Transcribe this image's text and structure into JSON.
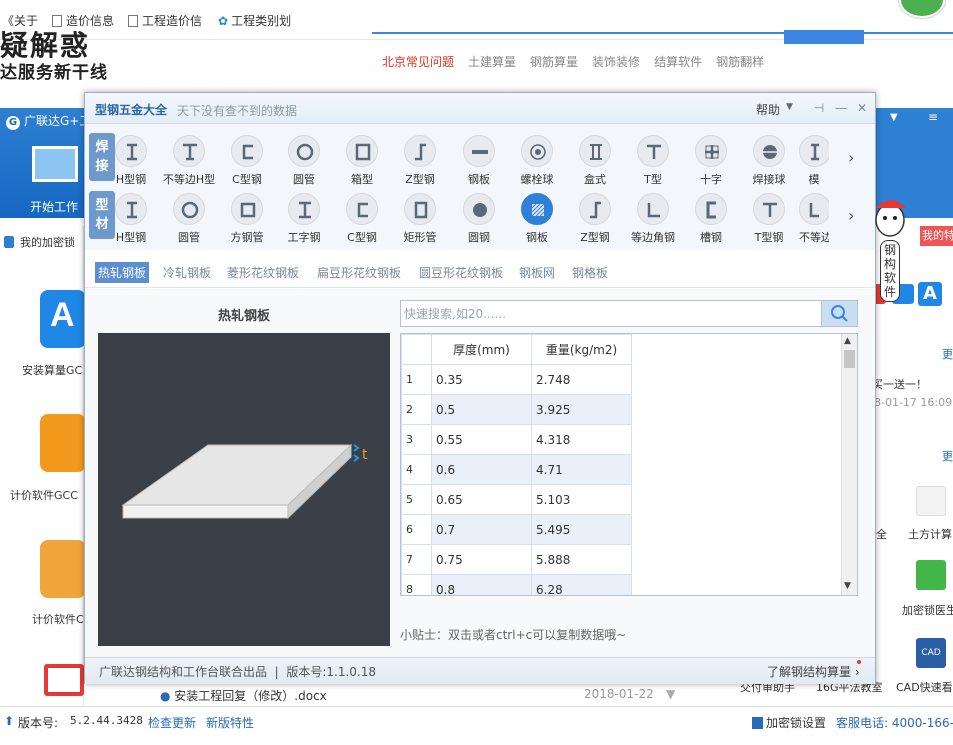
{
  "browser_bar": {
    "items": [
      "《关于",
      "造价信息",
      "工程造价信",
      "工程类别划"
    ]
  },
  "website": {
    "logo_line1": "疑解惑",
    "logo_line2": "达服务新干线",
    "links": [
      "北京常见问题",
      "土建算量",
      "钢筋算量",
      "装饰装修",
      "结算软件",
      "钢筋翻样"
    ]
  },
  "app": {
    "title": "广联达G+工",
    "start_work": "开始工作",
    "lock_label": "我的加密锁",
    "my_tab": "我的特",
    "left_apps": [
      "安装算量GC",
      "计价软件GCC",
      "计价软件C"
    ],
    "right_texts": {
      "more1": "更",
      "promo": "买一送一！",
      "date1": "8-01-17 16:09",
      "more2": "更",
      "quan": "全",
      "tufang": "土方计算",
      "jiamisuo": "加密锁医生",
      "cad": "CAD快速看",
      "jiaofu": "交付审助手",
      "g16": "16G平法教室"
    },
    "doc_row": {
      "name": "安装工程回复（修改）.docx",
      "date": "2018-01-22"
    },
    "status": {
      "version_label": "版本号:",
      "version": "5.2.44.3428",
      "check_update": "检查更新",
      "new_features": "新版特性",
      "lock_setting": "加密锁设置",
      "hotline": "客服电话: 4000-166-"
    }
  },
  "dialog": {
    "title": "型钢五金大全",
    "subtitle": "天下没有查不到的数据",
    "help": "帮助",
    "categories": [
      {
        "label": "焊\n接",
        "items": [
          "H型钢",
          "不等边H型",
          "C型钢",
          "圆管",
          "箱型",
          "Z型钢",
          "钢板",
          "螺栓球",
          "盒式",
          "T型",
          "十字",
          "焊接球",
          "模"
        ]
      },
      {
        "label": "型\n材",
        "items": [
          "H型钢",
          "圆管",
          "方钢管",
          "工字钢",
          "C型钢",
          "矩形管",
          "圆钢",
          "钢板",
          "Z型钢",
          "等边角钢",
          "槽钢",
          "T型钢",
          "不等边"
        ]
      }
    ],
    "selected_item": "钢板",
    "sub_tabs": [
      "热轧钢板",
      "冷轧钢板",
      "菱形花纹钢板",
      "扁豆形花纹钢板",
      "圆豆形花纹钢板",
      "钢板网",
      "钢格板"
    ],
    "active_sub_tab": "热轧钢板",
    "preview_title": "热轧钢板",
    "preview_dim_label": "t",
    "search_placeholder": "快速搜索,如20......",
    "table": {
      "headers": [
        "厚度(mm)",
        "重量(kg/m2)"
      ],
      "rows": [
        {
          "n": "1",
          "thickness": "0.35",
          "weight": "2.748"
        },
        {
          "n": "2",
          "thickness": "0.5",
          "weight": "3.925"
        },
        {
          "n": "3",
          "thickness": "0.55",
          "weight": "4.318"
        },
        {
          "n": "4",
          "thickness": "0.6",
          "weight": "4.71"
        },
        {
          "n": "5",
          "thickness": "0.65",
          "weight": "5.103"
        },
        {
          "n": "6",
          "thickness": "0.7",
          "weight": "5.495"
        },
        {
          "n": "7",
          "thickness": "0.75",
          "weight": "5.888"
        },
        {
          "n": "8",
          "thickness": "0.8",
          "weight": "6.28"
        }
      ]
    },
    "tip": "小贴士：双击或者ctrl+c可以复制数据哦~",
    "footer_left": "广联达钢结构和工作台联合出品",
    "version_text": "版本号:1.1.0.18",
    "footer_right": "了解钢结构算量",
    "mascot_text": "钢构软件"
  }
}
